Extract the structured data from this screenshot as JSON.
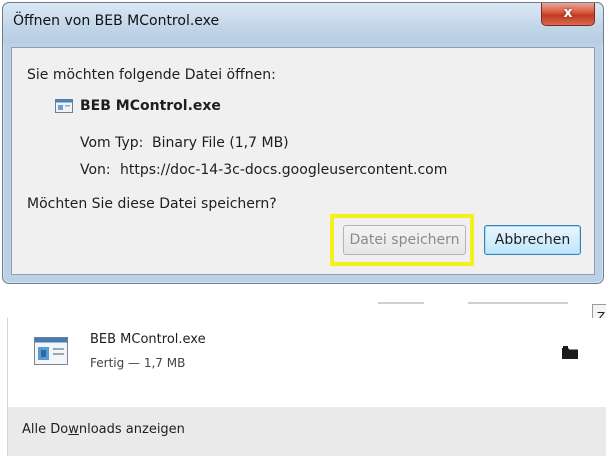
{
  "dialog": {
    "title": "Öffnen von BEB MControl.exe",
    "close_label": "x",
    "prompt": "Sie möchten folgende Datei öffnen:",
    "file_name": "BEB MControl.exe",
    "type_label": "Vom Typ:",
    "type_value": "Binary File (1,7 MB)",
    "from_label": "Von:",
    "from_value": "https://doc-14-3c-docs.googleusercontent.com",
    "question": "Möchten Sie diese Datei speichern?",
    "save_button": "Datei speichern",
    "cancel_button": "Abbrechen",
    "highlight_color": "#f2f21a"
  },
  "downloads": {
    "side_tab_label": "Z",
    "item": {
      "name": "BEB MControl.exe",
      "status": "Fertig — 1,7 MB",
      "icon": "exe-file-icon"
    },
    "folder_icon": "folder-icon",
    "footer_prefix": "Alle Do",
    "footer_underlined": "w",
    "footer_suffix": "nloads anzeigen"
  }
}
